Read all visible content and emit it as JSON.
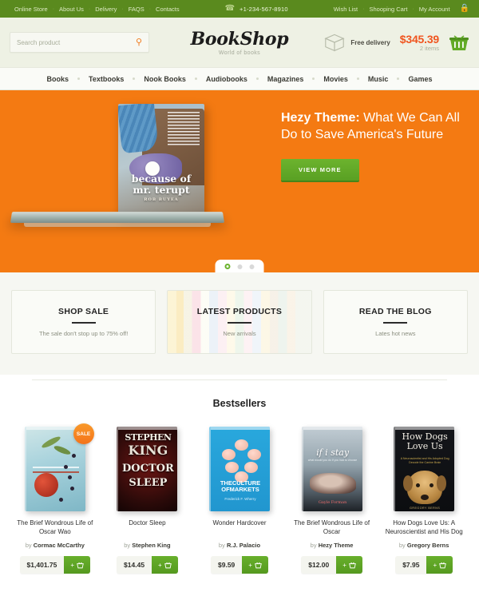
{
  "topbar": {
    "links": [
      "Online Store",
      "About Us",
      "Delivery",
      "FAQS",
      "Contacts"
    ],
    "phone_icon": "phone-icon",
    "phone": "+1-234-567-8910",
    "account_links": [
      "Wish List",
      "Shooping Cart",
      "My Account"
    ],
    "lock_icon": "lock-icon",
    "separator": "·",
    "bg_color": "#5a8a1e"
  },
  "header": {
    "search": {
      "value": "",
      "placeholder": "Search product",
      "icon": "search-icon"
    },
    "brand": {
      "name": "BookShop",
      "tagline": "World of books"
    },
    "delivery": {
      "icon": "box-icon",
      "label": "Free delivery"
    },
    "cart": {
      "total": "$345.39",
      "items": "2 items",
      "icon": "basket-icon"
    },
    "accent_color": "#f0551f",
    "bg_color": "#eef1e4"
  },
  "nav": {
    "items": [
      "Books",
      "Textbooks",
      "Nook Books",
      "Audiobooks",
      "Magazines",
      "Movies",
      "Music",
      "Games"
    ]
  },
  "hero": {
    "bg_color": "#f47a12",
    "book_cover": {
      "title_line1": "because of",
      "title_line2": "mr. terupt",
      "author": "ROB BUYEA"
    },
    "headline_bold": "Hezy Theme:",
    "headline_rest": " What We Can All Do to Save America's Future",
    "cta_label": "VIEW MORE",
    "cta_color": "#6cb32e",
    "carousel": {
      "total_dots": 3,
      "active_index": 0
    }
  },
  "promos": [
    {
      "title": "SHOP SALE",
      "subtitle": "The sale don't stop up to 75% off!",
      "has_books_bg": false
    },
    {
      "title": "LATEST PRODUCTS",
      "subtitle": "New arrivals",
      "has_books_bg": true
    },
    {
      "title": "READ THE BLOG",
      "subtitle": "Lates hot news",
      "has_books_bg": false
    }
  ],
  "bestsellers": {
    "title": "Bestsellers",
    "by_prefix": "by ",
    "add_to_cart_icon": "basket-plus-icon",
    "add_to_cart_label": "+",
    "sale_badge_label": "SALE",
    "products": [
      {
        "name": "The Brief Wondrous Life of Oscar Wao",
        "author": "Cormac McCarthy",
        "price": "$1,401.75",
        "on_sale": true,
        "cover_title": ""
      },
      {
        "name": "Doctor Sleep",
        "author": "Stephen King",
        "price": "$14.45",
        "on_sale": false,
        "cover_title": "STEPHEN KING DOCTOR SLEEP"
      },
      {
        "name": "Wonder Hardcover",
        "author": "R.J. Palacio",
        "price": "$9.59",
        "on_sale": false,
        "cover_title": "THECULTURE OFMARKETS",
        "cover_author": "Frederick F. Wherry"
      },
      {
        "name": "The Brief Wondrous Life of Oscar",
        "author": "Hezy Theme",
        "price": "$12.00",
        "on_sale": false,
        "cover_title": "if i stay",
        "cover_author": "Gayle Forman"
      },
      {
        "name": "How Dogs Love Us: A Neuroscientist and His Dog",
        "author": "Gregory Berns",
        "price": "$7.95",
        "on_sale": false,
        "cover_title": "How Dogs Love Us",
        "cover_sub": "A Neuroscientist and His Adopted Dog Decode the Canine Brain",
        "cover_author": "GREGORY BERNS"
      }
    ]
  }
}
